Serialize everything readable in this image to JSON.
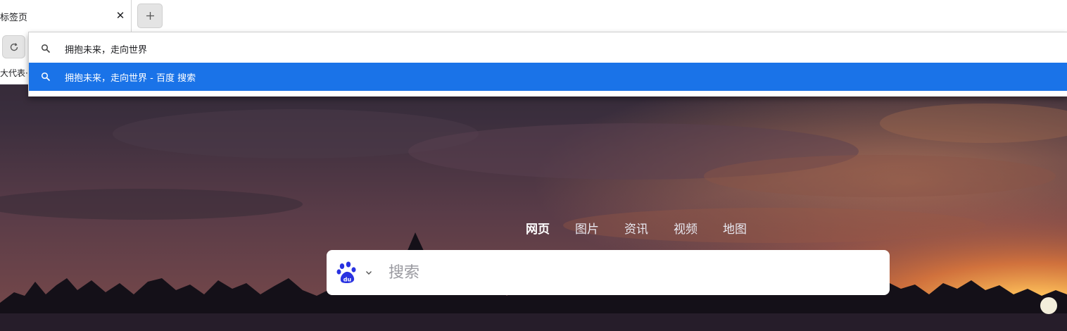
{
  "browser": {
    "tab": {
      "title": "标签页",
      "close_glyph": "✕"
    },
    "new_tab_icon": "plus-icon",
    "reload_icon": "reload-icon",
    "bookmark_fragment": "大代表··"
  },
  "omnibox": {
    "input_value": "拥抱未来，走向世界",
    "suggestions": [
      {
        "text": "拥抱未来，走向世界 - 百度 搜索",
        "icon": "search-icon",
        "selected": true
      }
    ],
    "accent_color": "#1a73e8"
  },
  "page": {
    "nav": [
      {
        "label": "网页",
        "active": true
      },
      {
        "label": "图片",
        "active": false
      },
      {
        "label": "资讯",
        "active": false
      },
      {
        "label": "视频",
        "active": false
      },
      {
        "label": "地图",
        "active": false
      }
    ],
    "search": {
      "placeholder": "搜索",
      "logo_icon": "baidu-paw-icon",
      "brand_color": "#2932e1"
    }
  }
}
